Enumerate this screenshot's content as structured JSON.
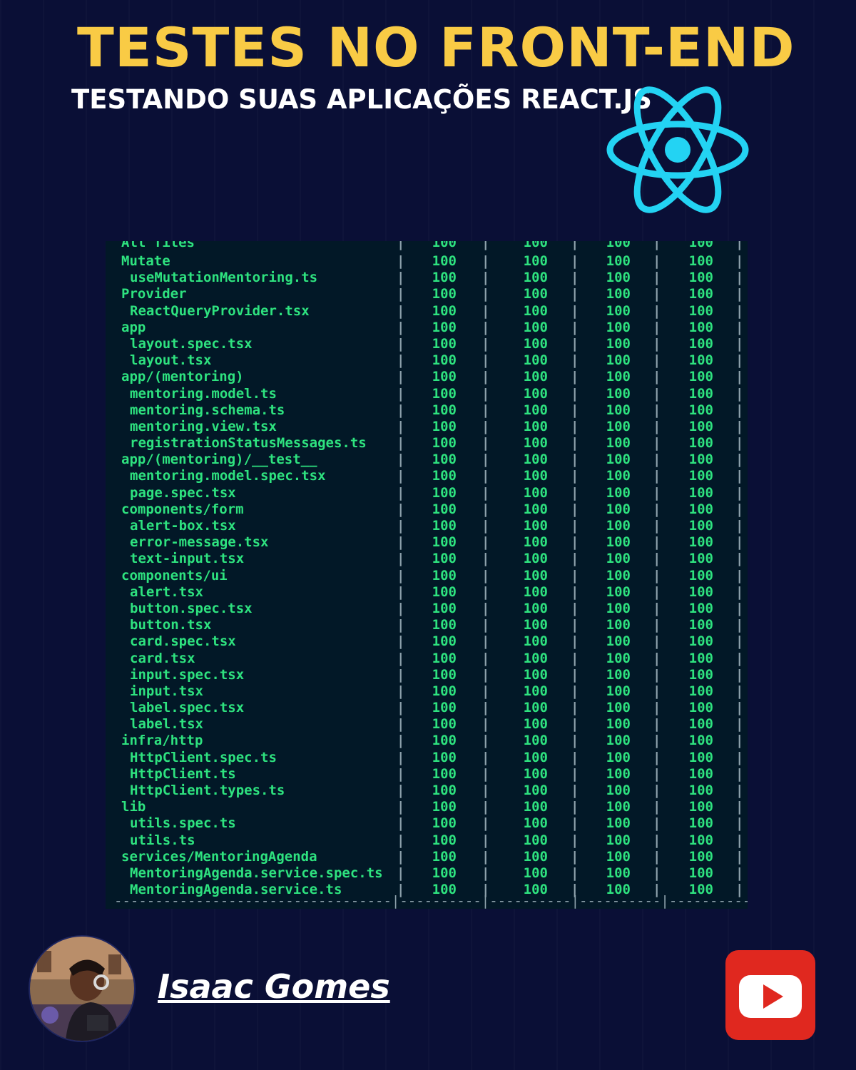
{
  "header": {
    "title": "TESTES NO FRONT-END",
    "subtitle": "TESTANDO SUAS APLICAÇÕES REACT.JS"
  },
  "icons": {
    "react": "react-logo-icon",
    "youtube": "youtube-play-icon"
  },
  "colors": {
    "background": "#0a0f36",
    "title": "#f9cb45",
    "react": "#23d3f3",
    "terminal_bg": "#021827",
    "terminal_text": "#2ee27f",
    "youtube": "#e0281f"
  },
  "coverage": {
    "top_partial": "All files",
    "rows": [
      {
        "file": "Mutate",
        "level": 0,
        "values": [
          "100",
          "100",
          "100",
          "100"
        ]
      },
      {
        "file": "useMutationMentoring.ts",
        "level": 1,
        "values": [
          "100",
          "100",
          "100",
          "100"
        ]
      },
      {
        "file": "Provider",
        "level": 0,
        "values": [
          "100",
          "100",
          "100",
          "100"
        ]
      },
      {
        "file": "ReactQueryProvider.tsx",
        "level": 1,
        "values": [
          "100",
          "100",
          "100",
          "100"
        ]
      },
      {
        "file": "app",
        "level": 0,
        "values": [
          "100",
          "100",
          "100",
          "100"
        ]
      },
      {
        "file": "layout.spec.tsx",
        "level": 1,
        "values": [
          "100",
          "100",
          "100",
          "100"
        ]
      },
      {
        "file": "layout.tsx",
        "level": 1,
        "values": [
          "100",
          "100",
          "100",
          "100"
        ]
      },
      {
        "file": "app/(mentoring)",
        "level": 0,
        "values": [
          "100",
          "100",
          "100",
          "100"
        ]
      },
      {
        "file": "mentoring.model.ts",
        "level": 1,
        "values": [
          "100",
          "100",
          "100",
          "100"
        ]
      },
      {
        "file": "mentoring.schema.ts",
        "level": 1,
        "values": [
          "100",
          "100",
          "100",
          "100"
        ]
      },
      {
        "file": "mentoring.view.tsx",
        "level": 1,
        "values": [
          "100",
          "100",
          "100",
          "100"
        ]
      },
      {
        "file": "registrationStatusMessages.ts",
        "level": 1,
        "values": [
          "100",
          "100",
          "100",
          "100"
        ]
      },
      {
        "file": "app/(mentoring)/__test__",
        "level": 0,
        "values": [
          "100",
          "100",
          "100",
          "100"
        ]
      },
      {
        "file": "mentoring.model.spec.tsx",
        "level": 1,
        "values": [
          "100",
          "100",
          "100",
          "100"
        ]
      },
      {
        "file": "page.spec.tsx",
        "level": 1,
        "values": [
          "100",
          "100",
          "100",
          "100"
        ]
      },
      {
        "file": "components/form",
        "level": 0,
        "values": [
          "100",
          "100",
          "100",
          "100"
        ]
      },
      {
        "file": "alert-box.tsx",
        "level": 1,
        "values": [
          "100",
          "100",
          "100",
          "100"
        ]
      },
      {
        "file": "error-message.tsx",
        "level": 1,
        "values": [
          "100",
          "100",
          "100",
          "100"
        ]
      },
      {
        "file": "text-input.tsx",
        "level": 1,
        "values": [
          "100",
          "100",
          "100",
          "100"
        ]
      },
      {
        "file": "components/ui",
        "level": 0,
        "values": [
          "100",
          "100",
          "100",
          "100"
        ]
      },
      {
        "file": "alert.tsx",
        "level": 1,
        "values": [
          "100",
          "100",
          "100",
          "100"
        ]
      },
      {
        "file": "button.spec.tsx",
        "level": 1,
        "values": [
          "100",
          "100",
          "100",
          "100"
        ]
      },
      {
        "file": "button.tsx",
        "level": 1,
        "values": [
          "100",
          "100",
          "100",
          "100"
        ]
      },
      {
        "file": "card.spec.tsx",
        "level": 1,
        "values": [
          "100",
          "100",
          "100",
          "100"
        ]
      },
      {
        "file": "card.tsx",
        "level": 1,
        "values": [
          "100",
          "100",
          "100",
          "100"
        ]
      },
      {
        "file": "input.spec.tsx",
        "level": 1,
        "values": [
          "100",
          "100",
          "100",
          "100"
        ]
      },
      {
        "file": "input.tsx",
        "level": 1,
        "values": [
          "100",
          "100",
          "100",
          "100"
        ]
      },
      {
        "file": "label.spec.tsx",
        "level": 1,
        "values": [
          "100",
          "100",
          "100",
          "100"
        ]
      },
      {
        "file": "label.tsx",
        "level": 1,
        "values": [
          "100",
          "100",
          "100",
          "100"
        ]
      },
      {
        "file": "infra/http",
        "level": 0,
        "values": [
          "100",
          "100",
          "100",
          "100"
        ]
      },
      {
        "file": "HttpClient.spec.ts",
        "level": 1,
        "values": [
          "100",
          "100",
          "100",
          "100"
        ]
      },
      {
        "file": "HttpClient.ts",
        "level": 1,
        "values": [
          "100",
          "100",
          "100",
          "100"
        ]
      },
      {
        "file": "HttpClient.types.ts",
        "level": 1,
        "values": [
          "100",
          "100",
          "100",
          "100"
        ]
      },
      {
        "file": "lib",
        "level": 0,
        "values": [
          "100",
          "100",
          "100",
          "100"
        ]
      },
      {
        "file": "utils.spec.ts",
        "level": 1,
        "values": [
          "100",
          "100",
          "100",
          "100"
        ]
      },
      {
        "file": "utils.ts",
        "level": 1,
        "values": [
          "100",
          "100",
          "100",
          "100"
        ]
      },
      {
        "file": "services/MentoringAgenda",
        "level": 0,
        "values": [
          "100",
          "100",
          "100",
          "100"
        ]
      },
      {
        "file": "MentoringAgenda.service.spec.ts",
        "level": 1,
        "values": [
          "100",
          "100",
          "100",
          "100"
        ]
      },
      {
        "file": "MentoringAgenda.service.ts",
        "level": 1,
        "values": [
          "100",
          "100",
          "100",
          "100"
        ]
      }
    ]
  },
  "footer": {
    "author": "Isaac Gomes"
  }
}
